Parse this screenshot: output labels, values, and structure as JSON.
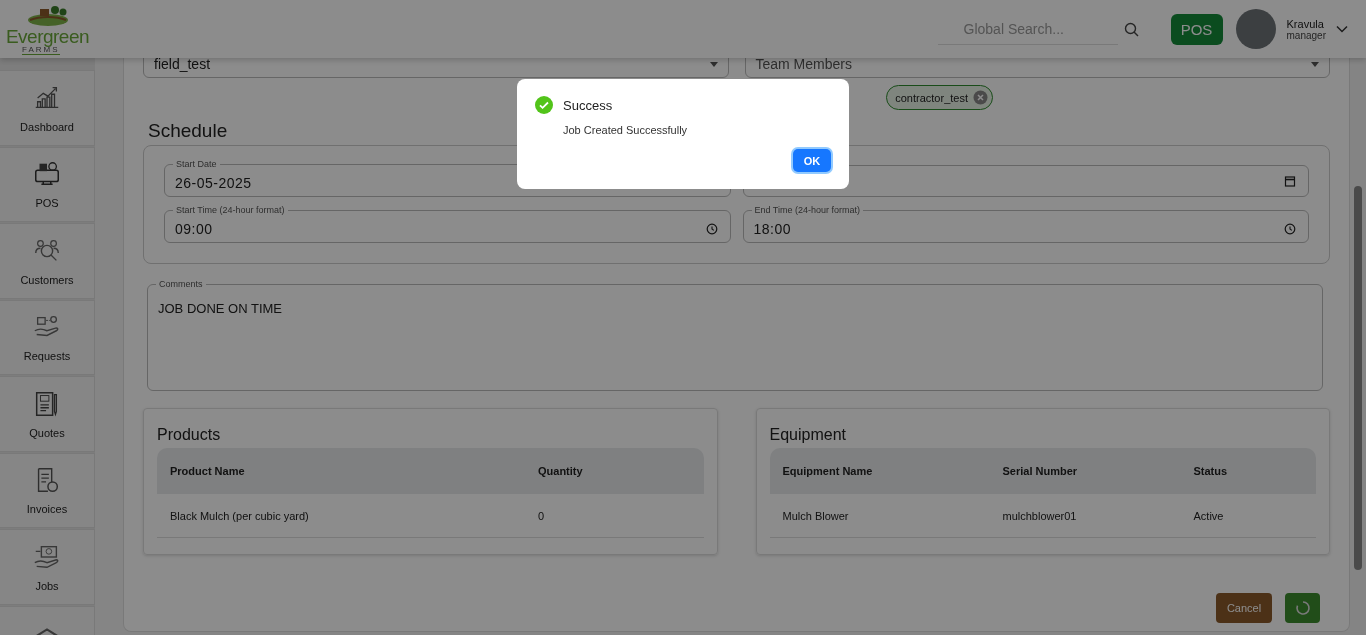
{
  "header": {
    "logo": {
      "name": "Evergreen",
      "tagline": "FARMS"
    },
    "search": {
      "placeholder": "Global Search..."
    },
    "pos_button": "POS",
    "user": {
      "name": "Kravula",
      "role": "manager"
    }
  },
  "sidebar": {
    "items": [
      {
        "label": "Dashboard",
        "kind": "chart"
      },
      {
        "label": "POS",
        "kind": "register"
      },
      {
        "label": "Customers",
        "kind": "people"
      },
      {
        "label": "Requests",
        "kind": "hand"
      },
      {
        "label": "Quotes",
        "kind": "quote"
      },
      {
        "label": "Invoices",
        "kind": "invoice"
      },
      {
        "label": "Jobs",
        "kind": "jobs"
      },
      {
        "kind": "box"
      }
    ]
  },
  "job": {
    "field": {
      "value": "field_test"
    },
    "team": {
      "placeholder": "Team Members",
      "chips": [
        "contractor_test"
      ]
    },
    "schedule": {
      "title": "Schedule",
      "fields": [
        {
          "kind": "date",
          "label": "Start Date",
          "value": "26-05-2025"
        },
        {
          "kind": "date"
        },
        {
          "kind": "time",
          "label": "Start Time (24-hour format)",
          "value": "09:00"
        },
        {
          "kind": "time",
          "label": "End Time (24-hour format)",
          "value": "18:00"
        }
      ]
    },
    "comments": {
      "label": "Comments",
      "value": "JOB DONE ON TIME"
    },
    "products": {
      "title": "Products",
      "columns": [
        "Product Name",
        "Quantity"
      ],
      "rows": [
        [
          "Black Mulch (per cubic yard)",
          "0"
        ]
      ]
    },
    "equipment": {
      "title": "Equipment",
      "columns": [
        "Equipment Name",
        "Serial Number",
        "Status"
      ],
      "rows": [
        [
          "Mulch Blower",
          "mulchblower01",
          "Active"
        ]
      ]
    },
    "actions": {
      "cancel": "Cancel",
      "submit_loading": true
    }
  },
  "dialog": {
    "kind": "success",
    "title": "Success",
    "message": "Job Created Successfully",
    "button": "OK"
  }
}
